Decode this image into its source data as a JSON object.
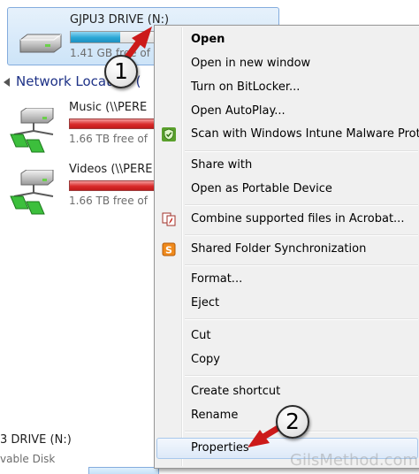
{
  "explorer": {
    "selected_drive": {
      "name": "GJPU3 DRIVE (N:)",
      "free_text": "1.41 GB free of",
      "usage_fraction": 0.6,
      "icon": "usb-drive-icon"
    },
    "group_header": "Network Location (",
    "network_drives": [
      {
        "name": "Music (\\\\PERE",
        "free_text": "1.66 TB free of",
        "icon": "network-drive-icon"
      },
      {
        "name": "Videos (\\\\PERE",
        "free_text": "1.66 TB free of",
        "icon": "network-drive-icon"
      }
    ],
    "bottom_drive": {
      "name": "3 DRIVE (N:)",
      "type_text": "vable Disk"
    }
  },
  "context_menu": {
    "items": [
      {
        "label": "Open",
        "bold": true
      },
      {
        "label": "Open in new window"
      },
      {
        "label": "Turn on BitLocker..."
      },
      {
        "label": "Open AutoPlay..."
      },
      {
        "label": "Scan with Windows Intune Malware Prot",
        "icon": "intune-shield-icon"
      },
      {
        "label": "Share with"
      },
      {
        "label": "Open as Portable Device"
      },
      {
        "label": "Combine supported files in Acrobat...",
        "icon": "acrobat-combine-icon"
      },
      {
        "label": "Shared Folder Synchronization",
        "icon": "sync-icon"
      },
      {
        "label": "Format..."
      },
      {
        "label": "Eject"
      },
      {
        "label": "Cut"
      },
      {
        "label": "Copy"
      },
      {
        "label": "Create shortcut"
      },
      {
        "label": "Rename"
      },
      {
        "label": "Properties",
        "highlighted": true
      }
    ]
  },
  "annotations": {
    "callout_1": "1",
    "callout_2": "2",
    "arrow_color": "#cc1a1a"
  },
  "watermark": "GilsMethod.com",
  "colors": {
    "selection_bg": "#cde4f8",
    "usage_bar_blue": "#2aa7d6",
    "usage_bar_red": "#d92b2b",
    "menu_bg": "#f0f0f0",
    "group_header": "#1e3287"
  }
}
